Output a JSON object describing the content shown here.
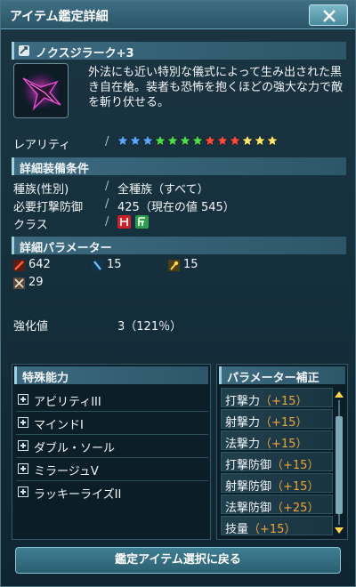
{
  "window": {
    "title": "アイテム鑑定詳細"
  },
  "item": {
    "name": "ノクスジラーク+3",
    "description": "外法にも近い特別な儀式によって生み出された黒き自在槍。装者も恐怖を抱くほどの強大な力で敵を斬り伏せる。"
  },
  "rarity": {
    "label": "レアリティ",
    "stars_total": 13,
    "star_colors": [
      "#5aa6ff",
      "#5aa6ff",
      "#5aa6ff",
      "#4fdc4a",
      "#4fdc4a",
      "#4fdc4a",
      "#4fdc4a",
      "#ff4a3a",
      "#ff4a3a",
      "#ff4a3a",
      "#ffe66a",
      "#ffe66a",
      "#ffe66a"
    ]
  },
  "requirements": {
    "section_title": "詳細装備条件",
    "race_label": "種族(性別)",
    "race_value": "全種族（すべて）",
    "defense_label": "必要打撃防御",
    "defense_value": "425（現在の値 545）",
    "class_label": "クラス",
    "class_icons": [
      "hunter-class-icon",
      "fighter-class-icon"
    ]
  },
  "params": {
    "section_title": "詳細パラメーター",
    "strike": "642",
    "shot": "15",
    "tech": "15",
    "element": "29"
  },
  "grind": {
    "label": "強化値",
    "value": "3（121％）"
  },
  "abilities": {
    "title": "特殊能力",
    "items": [
      "アビリティIII",
      "マインドI",
      "ダブル・ソール",
      "ミラージュV",
      "ラッキーライズII"
    ]
  },
  "param_bonus": {
    "title": "パラメーター補正",
    "items": [
      {
        "name": "打撃力",
        "bonus": "（+15）"
      },
      {
        "name": "射撃力",
        "bonus": "（+15）"
      },
      {
        "name": "法撃力",
        "bonus": "（+15）"
      },
      {
        "name": "打撃防御",
        "bonus": "（+15）"
      },
      {
        "name": "射撃防御",
        "bonus": "（+15）"
      },
      {
        "name": "法撃防御",
        "bonus": "（+25）"
      },
      {
        "name": "技量",
        "bonus": "（+15）"
      }
    ]
  },
  "footer": {
    "button_label": "鑑定アイテム選択に戻る"
  },
  "colors": {
    "accent": "#f0a43a",
    "header": "#3c6a80"
  }
}
